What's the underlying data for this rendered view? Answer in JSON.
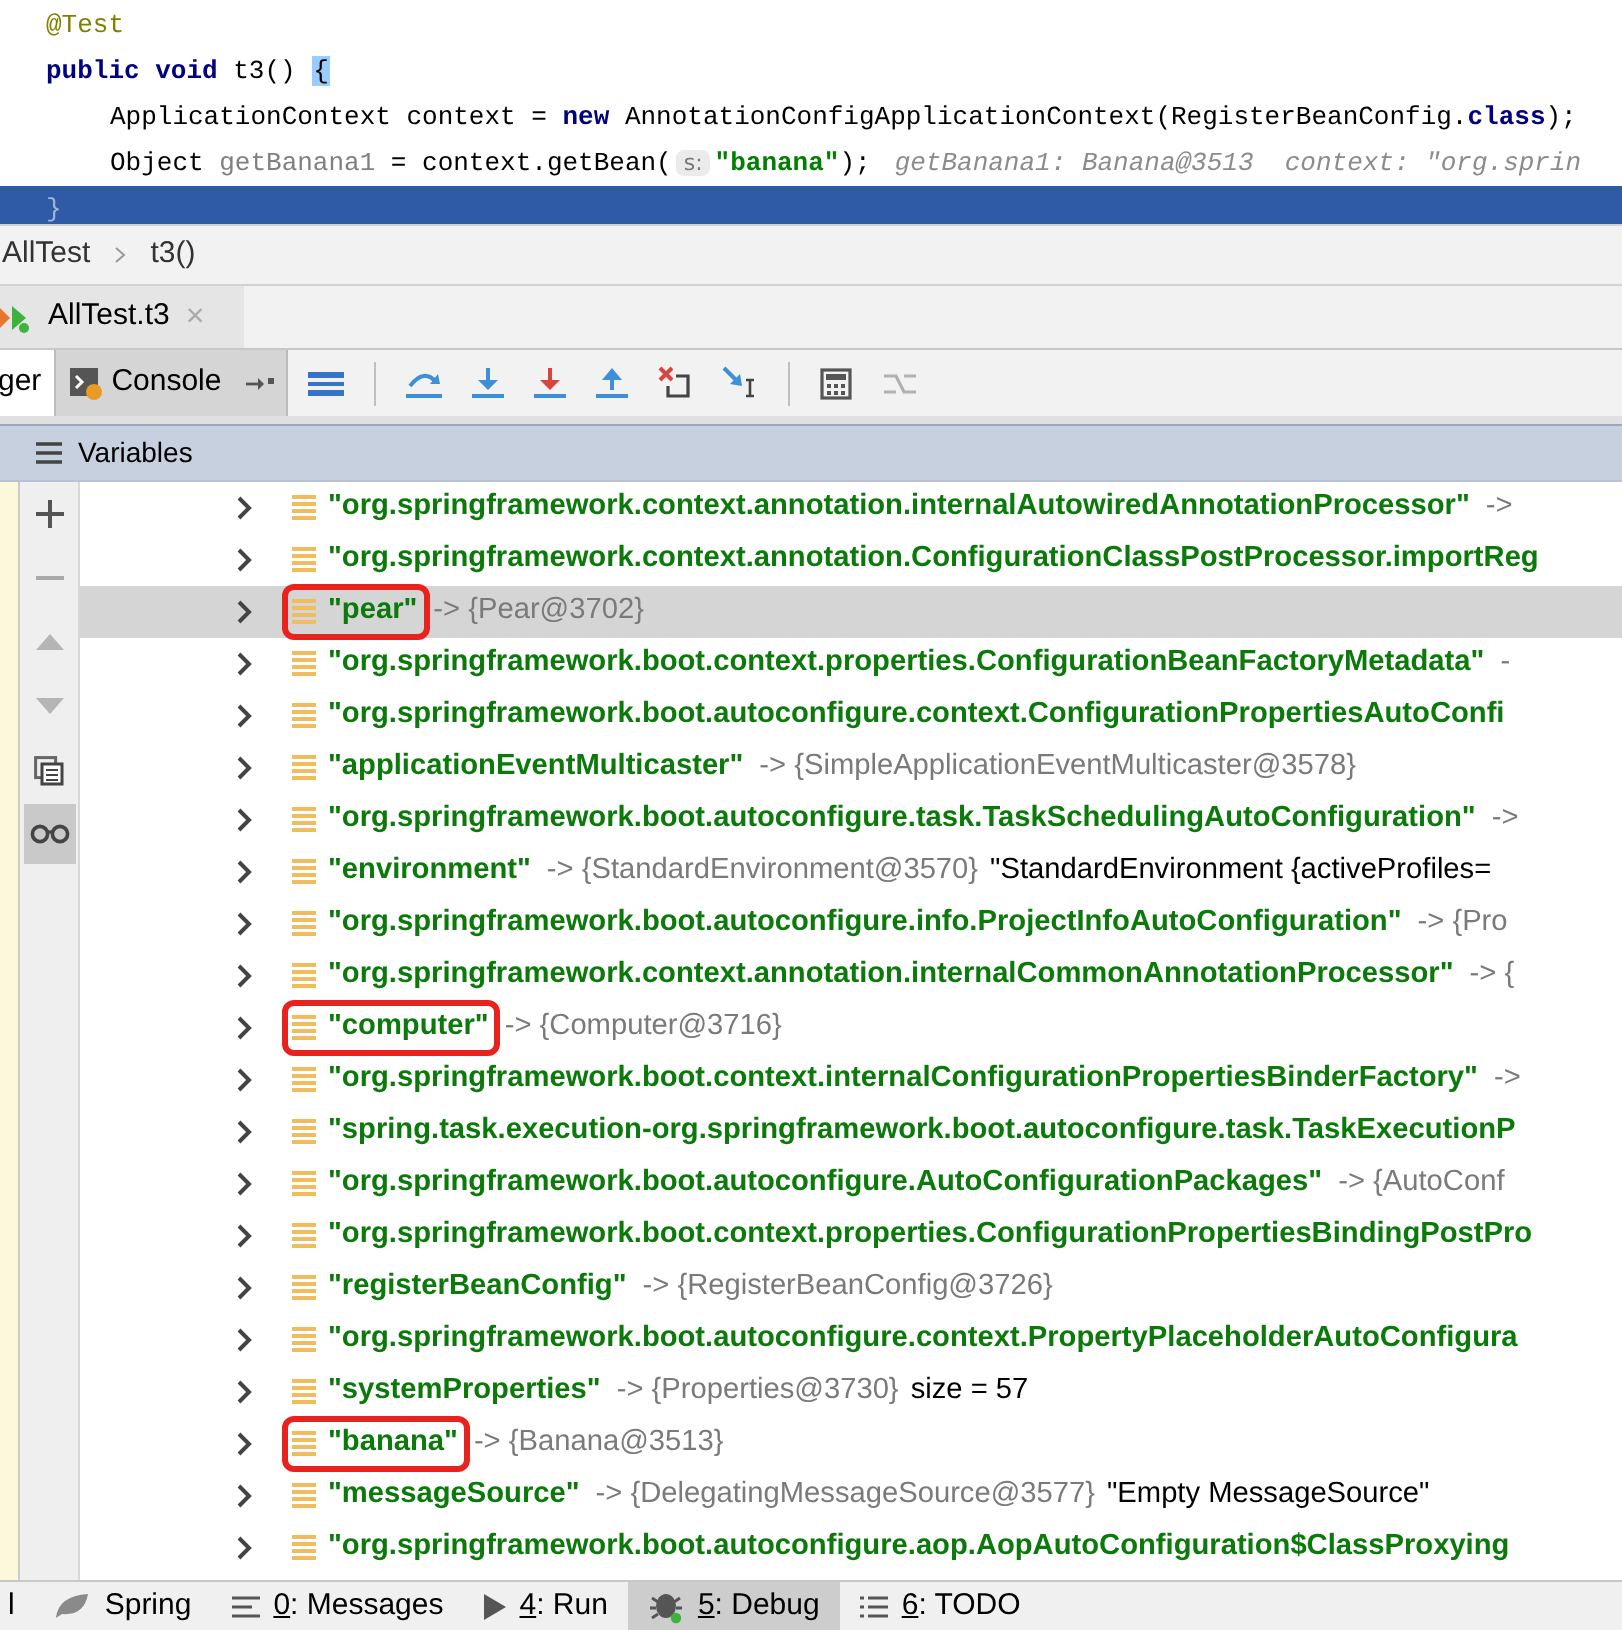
{
  "editor": {
    "lines": [
      {
        "current": false,
        "tokens": [
          {
            "kind": "annotation",
            "text": "@Test"
          }
        ]
      },
      {
        "current": false,
        "tokens": [
          {
            "kind": "keyword",
            "text": "public void"
          },
          {
            "kind": "plain",
            "text": " t3() "
          },
          {
            "kind": "brace_match",
            "text": "{"
          }
        ],
        "children": [
          {
            "current": false,
            "tokens": [
              {
                "kind": "plain",
                "text": "ApplicationContext context = "
              },
              {
                "kind": "keyword",
                "text": "new"
              },
              {
                "kind": "plain",
                "text": " AnnotationConfigApplicationContext(RegisterBeanConfig."
              },
              {
                "kind": "keyword",
                "text": "class"
              },
              {
                "kind": "plain",
                "text": ");"
              }
            ]
          },
          {
            "current": false,
            "tokens": [
              {
                "kind": "plain",
                "text": "Object "
              },
              {
                "kind": "unused",
                "text": "getBanana1"
              },
              {
                "kind": "plain",
                "text": " = context.getBean("
              },
              {
                "kind": "param_hint",
                "text": "s:"
              },
              {
                "kind": "string",
                "text": "\"banana\""
              },
              {
                "kind": "plain",
                "text": ");"
              },
              {
                "kind": "inline_value",
                "text": "getBanana1: Banana@3513  context: \"org.sprin"
              }
            ]
          }
        ]
      },
      {
        "current": true,
        "tokens": [
          {
            "kind": "faint",
            "text": "}"
          }
        ]
      }
    ]
  },
  "breadcrumb": [
    "AllTest",
    "t3()"
  ],
  "session_tab": {
    "label": "AllTest.t3",
    "close": "×"
  },
  "debugger_tabs": [
    {
      "label": "ger",
      "selected": true,
      "kind": "plain"
    },
    {
      "label": "Console",
      "selected": false,
      "kind": "console"
    }
  ],
  "toolbar_buttons": [
    {
      "kind": "frames"
    },
    {
      "kind": "step_over"
    },
    {
      "kind": "step_into"
    },
    {
      "kind": "force_step_into"
    },
    {
      "kind": "step_out"
    },
    {
      "kind": "drop_frame"
    },
    {
      "kind": "run_to_cursor"
    },
    {
      "kind": "evaluate"
    },
    {
      "kind": "trace",
      "disabled": true
    }
  ],
  "variables_panel": {
    "title": "Variables",
    "side_tools": [
      {
        "kind": "add"
      },
      {
        "kind": "remove"
      },
      {
        "kind": "up"
      },
      {
        "kind": "down"
      },
      {
        "kind": "copy"
      },
      {
        "kind": "watch",
        "selected": true
      }
    ],
    "rows": [
      {
        "name": "\"org.springframework.context.annotation.internalAutowiredAnnotationProcessor\"",
        "value": "->",
        "selected": false,
        "highlighted": false
      },
      {
        "name": "\"org.springframework.context.annotation.ConfigurationClassPostProcessor.importReg",
        "selected": false,
        "highlighted": false
      },
      {
        "name": "\"pear\"",
        "value": "-> {Pear@3702}",
        "selected": true,
        "highlighted": true
      },
      {
        "name": "\"org.springframework.boot.context.properties.ConfigurationBeanFactoryMetadata\"",
        "value": "-",
        "selected": false,
        "highlighted": false
      },
      {
        "name": "\"org.springframework.boot.autoconfigure.context.ConfigurationPropertiesAutoConfi",
        "selected": false,
        "highlighted": false
      },
      {
        "name": "\"applicationEventMulticaster\"",
        "value": "-> {SimpleApplicationEventMulticaster@3578}",
        "selected": false,
        "highlighted": false
      },
      {
        "name": "\"org.springframework.boot.autoconfigure.task.TaskSchedulingAutoConfiguration\"",
        "value": "->",
        "selected": false,
        "highlighted": false
      },
      {
        "name": "\"environment\"",
        "value": "-> {StandardEnvironment@3570}",
        "extra": "\"StandardEnvironment {activeProfiles=",
        "selected": false,
        "highlighted": false
      },
      {
        "name": "\"org.springframework.boot.autoconfigure.info.ProjectInfoAutoConfiguration\"",
        "value": "-> {Pro",
        "selected": false,
        "highlighted": false
      },
      {
        "name": "\"org.springframework.context.annotation.internalCommonAnnotationProcessor\"",
        "value": "-> {",
        "selected": false,
        "highlighted": false
      },
      {
        "name": "\"computer\"",
        "value": "-> {Computer@3716}",
        "selected": false,
        "highlighted": true
      },
      {
        "name": "\"org.springframework.boot.context.internalConfigurationPropertiesBinderFactory\"",
        "value": "->",
        "selected": false,
        "highlighted": false
      },
      {
        "name": "\"spring.task.execution-org.springframework.boot.autoconfigure.task.TaskExecutionP",
        "selected": false,
        "highlighted": false
      },
      {
        "name": "\"org.springframework.boot.autoconfigure.AutoConfigurationPackages\"",
        "value": "-> {AutoConf",
        "selected": false,
        "highlighted": false
      },
      {
        "name": "\"org.springframework.boot.context.properties.ConfigurationPropertiesBindingPostPro",
        "selected": false,
        "highlighted": false
      },
      {
        "name": "\"registerBeanConfig\"",
        "value": "-> {RegisterBeanConfig@3726}",
        "selected": false,
        "highlighted": false
      },
      {
        "name": "\"org.springframework.boot.autoconfigure.context.PropertyPlaceholderAutoConfigura",
        "selected": false,
        "highlighted": false
      },
      {
        "name": "\"systemProperties\"",
        "value": "-> {Properties@3730}",
        "extra": "size = 57",
        "selected": false,
        "highlighted": false
      },
      {
        "name": "\"banana\"",
        "value": "-> {Banana@3513}",
        "selected": false,
        "highlighted": true
      },
      {
        "name": "\"messageSource\"",
        "value": "-> {DelegatingMessageSource@3577}",
        "extra": "\"Empty MessageSource\"",
        "selected": false,
        "highlighted": false
      },
      {
        "name": "\"org.springframework.boot.autoconfigure.aop.AopAutoConfiguration$ClassProxying",
        "selected": false,
        "highlighted": false
      }
    ]
  },
  "bottom_bar": [
    {
      "kind": "plain",
      "text": "l",
      "selected": false
    },
    {
      "kind": "spring",
      "text": "Spring",
      "selected": false
    },
    {
      "kind": "messages",
      "key": "0",
      "text": ": Messages",
      "selected": false
    },
    {
      "kind": "run",
      "key": "4",
      "text": ": Run",
      "selected": false
    },
    {
      "kind": "debug",
      "key": "5",
      "text": ": Debug",
      "selected": true
    },
    {
      "kind": "todo",
      "key": "6",
      "text": ": TODO",
      "selected": false
    }
  ]
}
